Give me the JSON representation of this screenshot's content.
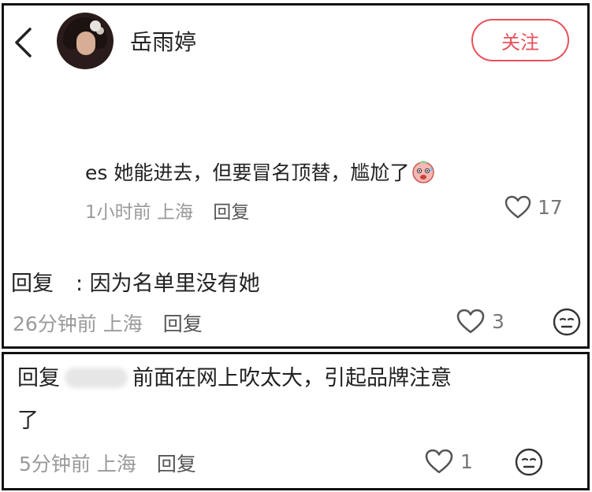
{
  "header": {
    "username": "岳雨婷",
    "follow_label": "关注"
  },
  "comment": {
    "text": "es 她能进去，但要冒名顶替，尴尬了",
    "time": "1小时前",
    "location": "上海",
    "reply_label": "回复",
    "likes": "17"
  },
  "reply1": {
    "prefix": "回复",
    "text": ": 因为名单里没有她",
    "time": "26分钟前",
    "location": "上海",
    "reply_label": "回复",
    "likes": "3"
  },
  "reply2": {
    "prefix": "回复",
    "text_line1": "前面在网上吹太大，引起品牌注意",
    "text_line2": "了",
    "time": "5分钟前",
    "location": "上海",
    "reply_label": "回复",
    "likes": "1"
  },
  "icons": {
    "back": "chevron-left-icon",
    "like": "heart-outline-icon",
    "emoji": "neutral-face-icon",
    "awkward": "sweating-face-emoji"
  },
  "colors": {
    "accent": "#e8505b",
    "meta_text": "#9a9a9a",
    "border": "#111111"
  }
}
